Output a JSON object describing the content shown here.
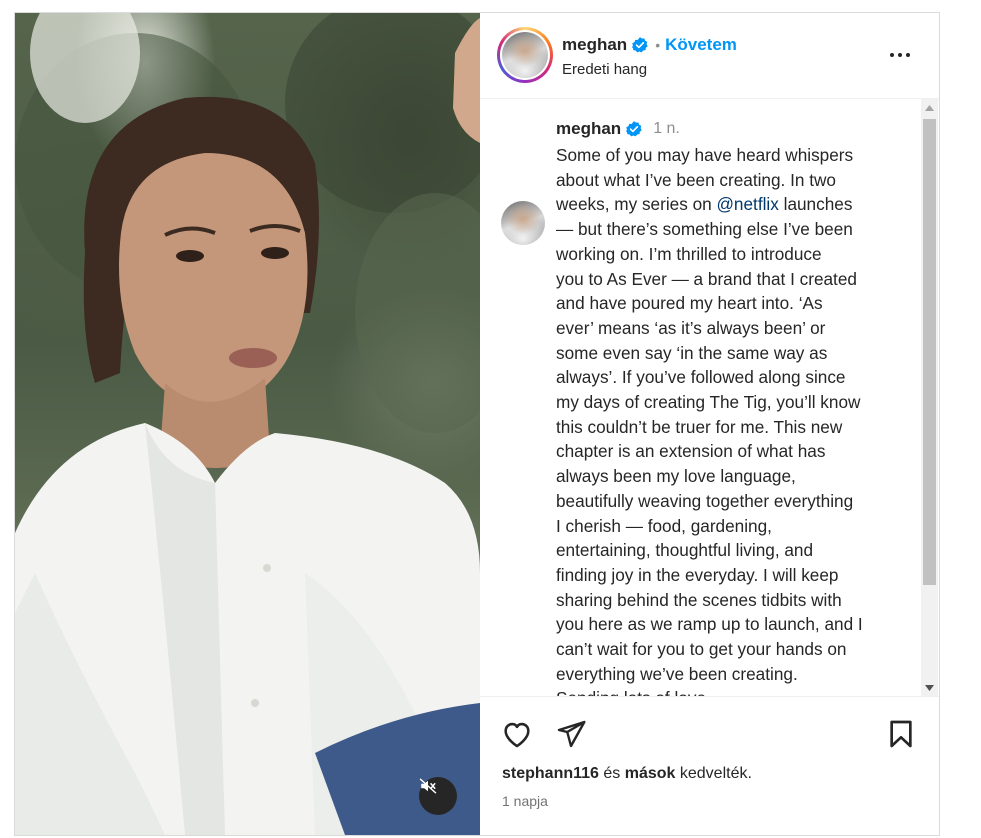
{
  "header": {
    "username": "meghan",
    "follow_label": "Követem",
    "separator": "•",
    "audio_label": "Eredeti hang"
  },
  "caption": {
    "username": "meghan",
    "time": "1 n.",
    "lines": [
      "Some of you may have heard whispers",
      "about what I’ve been creating. In two",
      "weeks, my series on ",
      "— but there’s something else I’ve been",
      "working on. I’m thrilled to introduce",
      "you to As Ever — a brand that I created",
      "and have poured my heart into. ‘As",
      "ever’ means ‘as it’s always been’ or",
      "some even say ‘in the same way as",
      "always’. If you’ve followed along since",
      "my days of creating The Tig, you’ll know",
      "this couldn’t be truer for me. This new",
      "chapter is an extension of what has",
      "always been my love language,",
      "beautifully weaving together everything",
      "I cherish — food, gardening,",
      "entertaining, thoughtful living, and",
      "finding joy in the everyday. I will keep",
      "sharing behind the scenes tidbits with",
      "you here as we ramp up to launch, and I",
      "can’t wait for you to get your hands on",
      "everything we’ve been creating.",
      "Sending lots of love"
    ],
    "mention": "@netflix",
    "after_mention": " launches"
  },
  "likes": {
    "user": "stephann116",
    "connector": " és ",
    "others": "mások",
    "suffix": " kedvelték."
  },
  "posted_ago": "1 napja",
  "icons": {
    "verified": "verified-badge-icon",
    "more": "more-options-icon",
    "like": "heart-icon",
    "share": "paper-plane-icon",
    "save": "bookmark-icon",
    "mute": "speaker-muted-icon"
  },
  "colors": {
    "accent": "#0095f6",
    "verified": "#0095f6",
    "mention": "#00376b",
    "muted_text": "#737373"
  }
}
